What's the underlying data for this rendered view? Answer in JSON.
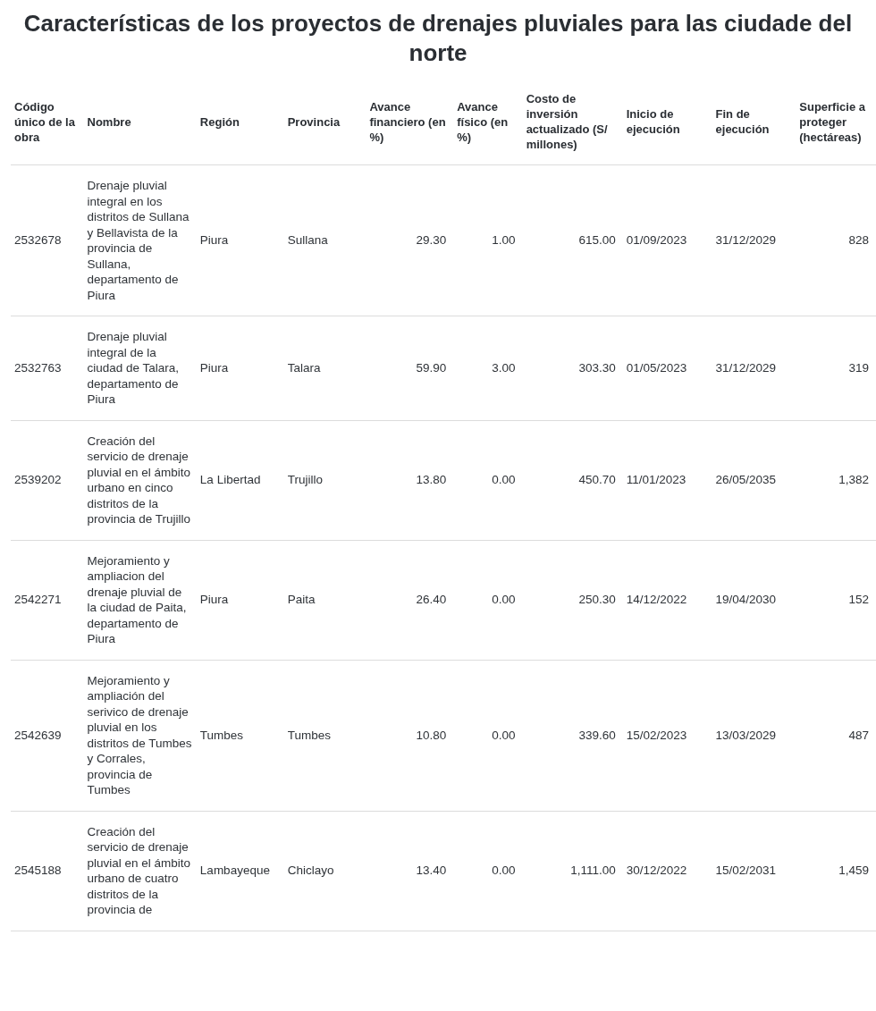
{
  "title": "Características de los proyectos de drenajes pluviales para las ciudade del norte",
  "table": {
    "columns": [
      "Código único de la obra",
      "Nombre",
      "Región",
      "Provincia",
      "Avance financiero (en %)",
      "Avance físico (en %)",
      "Costo de inversión actualizado (S/ millones)",
      "Inicio de ejecución",
      "Fin de ejecución",
      "Superficie a proteger (hectáreas)"
    ],
    "rows": [
      {
        "cells": [
          "2532678",
          "Drenaje pluvial integral en los distritos de Sullana y Bellavista de la provincia de Sullana, departamento de Piura",
          "Piura",
          "Sullana",
          "29.30",
          "1.00",
          "615.00",
          "01/09/2023",
          "31/12/2029",
          "828"
        ]
      },
      {
        "cells": [
          "2532763",
          "Drenaje pluvial integral de la ciudad de Talara, departamento de Piura",
          "Piura",
          "Talara",
          "59.90",
          "3.00",
          "303.30",
          "01/05/2023",
          "31/12/2029",
          "319"
        ]
      },
      {
        "cells": [
          "2539202",
          "Creación del servicio de drenaje pluvial en el ámbito urbano en cinco distritos de la provincia de Trujillo",
          "La Libertad",
          "Trujillo",
          "13.80",
          "0.00",
          "450.70",
          "11/01/2023",
          "26/05/2035",
          "1,382"
        ]
      },
      {
        "cells": [
          "2542271",
          "Mejoramiento y ampliacion del drenaje pluvial de la ciudad de Paita, departamento de Piura",
          "Piura",
          "Paita",
          "26.40",
          "0.00",
          "250.30",
          "14/12/2022",
          "19/04/2030",
          "152"
        ]
      },
      {
        "cells": [
          "2542639",
          "Mejoramiento y ampliación del serivico de drenaje pluvial en los distritos de Tumbes y Corrales, provincia de Tumbes",
          "Tumbes",
          "Tumbes",
          "10.80",
          "0.00",
          "339.60",
          "15/02/2023",
          "13/03/2029",
          "487"
        ]
      },
      {
        "cells": [
          "2545188",
          "Creación del servicio de drenaje pluvial en el ámbito urbano de cuatro distritos de la provincia de",
          "Lambayeque",
          "Chiclayo",
          "13.40",
          "0.00",
          "1,111.00",
          "30/12/2022",
          "15/02/2031",
          "1,459"
        ]
      }
    ]
  }
}
